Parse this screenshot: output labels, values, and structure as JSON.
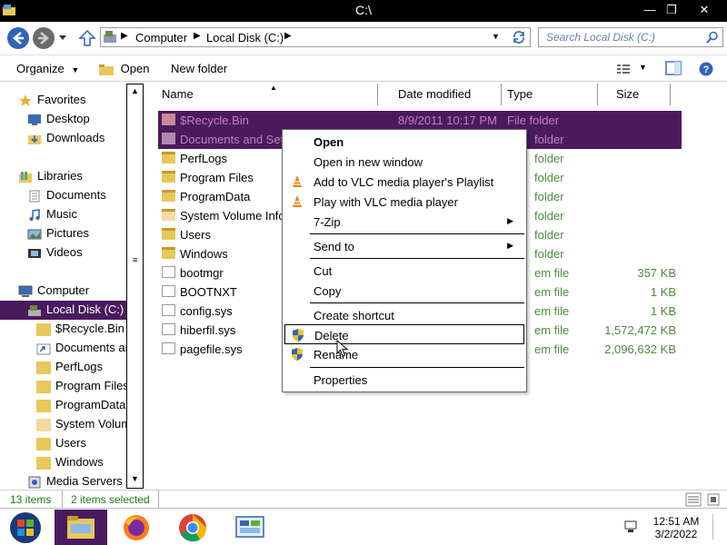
{
  "window": {
    "title": "C:\\",
    "minimize": "—",
    "maximize": "❐",
    "close": "✕"
  },
  "address": {
    "crumbs": [
      "Computer",
      "Local Disk (C:)"
    ],
    "search_placeholder": "Search Local Disk (C:)"
  },
  "toolbar": {
    "organize": "Organize",
    "open": "Open",
    "new_folder": "New folder"
  },
  "nav": {
    "favorites": "Favorites",
    "desktop": "Desktop",
    "downloads": "Downloads",
    "libraries": "Libraries",
    "documents": "Documents",
    "music": "Music",
    "pictures": "Pictures",
    "videos": "Videos",
    "computer": "Computer",
    "local_disk": "Local Disk (C:)",
    "sub": [
      "$Recycle.Bin",
      "Documents an",
      "PerfLogs",
      "Program Files",
      "ProgramData",
      "System Volume",
      "Users",
      "Windows"
    ],
    "media_servers": "Media Servers"
  },
  "columns": {
    "name": "Name",
    "date": "Date modified",
    "type": "Type",
    "size": "Size"
  },
  "files": [
    {
      "name": "$Recycle.Bin",
      "date": "8/9/2011 10:17 PM",
      "type": "File folder",
      "size": "",
      "selected": true,
      "kind": "folder"
    },
    {
      "name": "Documents and Settings",
      "date": "",
      "type": "folder",
      "size": "",
      "selected": true,
      "kind": "shortcut"
    },
    {
      "name": "PerfLogs",
      "date": "",
      "type": "folder",
      "size": "",
      "selected": false,
      "kind": "folder"
    },
    {
      "name": "Program Files",
      "date": "",
      "type": "folder",
      "size": "",
      "selected": false,
      "kind": "folder"
    },
    {
      "name": "ProgramData",
      "date": "",
      "type": "folder",
      "size": "",
      "selected": false,
      "kind": "folder"
    },
    {
      "name": "System Volume Information",
      "date": "",
      "type": "folder",
      "size": "",
      "selected": false,
      "kind": "folder"
    },
    {
      "name": "Users",
      "date": "",
      "type": "folder",
      "size": "",
      "selected": false,
      "kind": "folder"
    },
    {
      "name": "Windows",
      "date": "",
      "type": "folder",
      "size": "",
      "selected": false,
      "kind": "folder"
    },
    {
      "name": "bootmgr",
      "date": "",
      "type": "em file",
      "size": "357 KB",
      "selected": false,
      "kind": "file"
    },
    {
      "name": "BOOTNXT",
      "date": "",
      "type": "em file",
      "size": "1 KB",
      "selected": false,
      "kind": "file"
    },
    {
      "name": "config.sys",
      "date": "",
      "type": "em file",
      "size": "1 KB",
      "selected": false,
      "kind": "file"
    },
    {
      "name": "hiberfil.sys",
      "date": "",
      "type": "em file",
      "size": "1,572,472 KB",
      "selected": false,
      "kind": "file"
    },
    {
      "name": "pagefile.sys",
      "date": "",
      "type": "em file",
      "size": "2,096,632 KB",
      "selected": false,
      "kind": "file"
    }
  ],
  "context_menu": {
    "open": "Open",
    "open_new_window": "Open in new window",
    "vlc_playlist": "Add to VLC media player's Playlist",
    "vlc_play": "Play with VLC media player",
    "zip": "7-Zip",
    "send_to": "Send to",
    "cut": "Cut",
    "copy": "Copy",
    "create_shortcut": "Create shortcut",
    "delete": "Delete",
    "rename": "Rename",
    "properties": "Properties"
  },
  "status": {
    "items": "13 items",
    "selected": "2 items selected"
  },
  "clock": {
    "time": "12:51 AM",
    "date": "3/2/2022"
  },
  "colors": {
    "selection": "#4a1a5e",
    "status_text": "#1a7a1a",
    "link_blue": "#1a5fb4"
  },
  "icons": {
    "back": "back-arrow-icon",
    "forward": "forward-arrow-icon",
    "up": "up-arrow-icon",
    "refresh": "refresh-icon",
    "search": "search-icon",
    "help": "help-icon"
  }
}
